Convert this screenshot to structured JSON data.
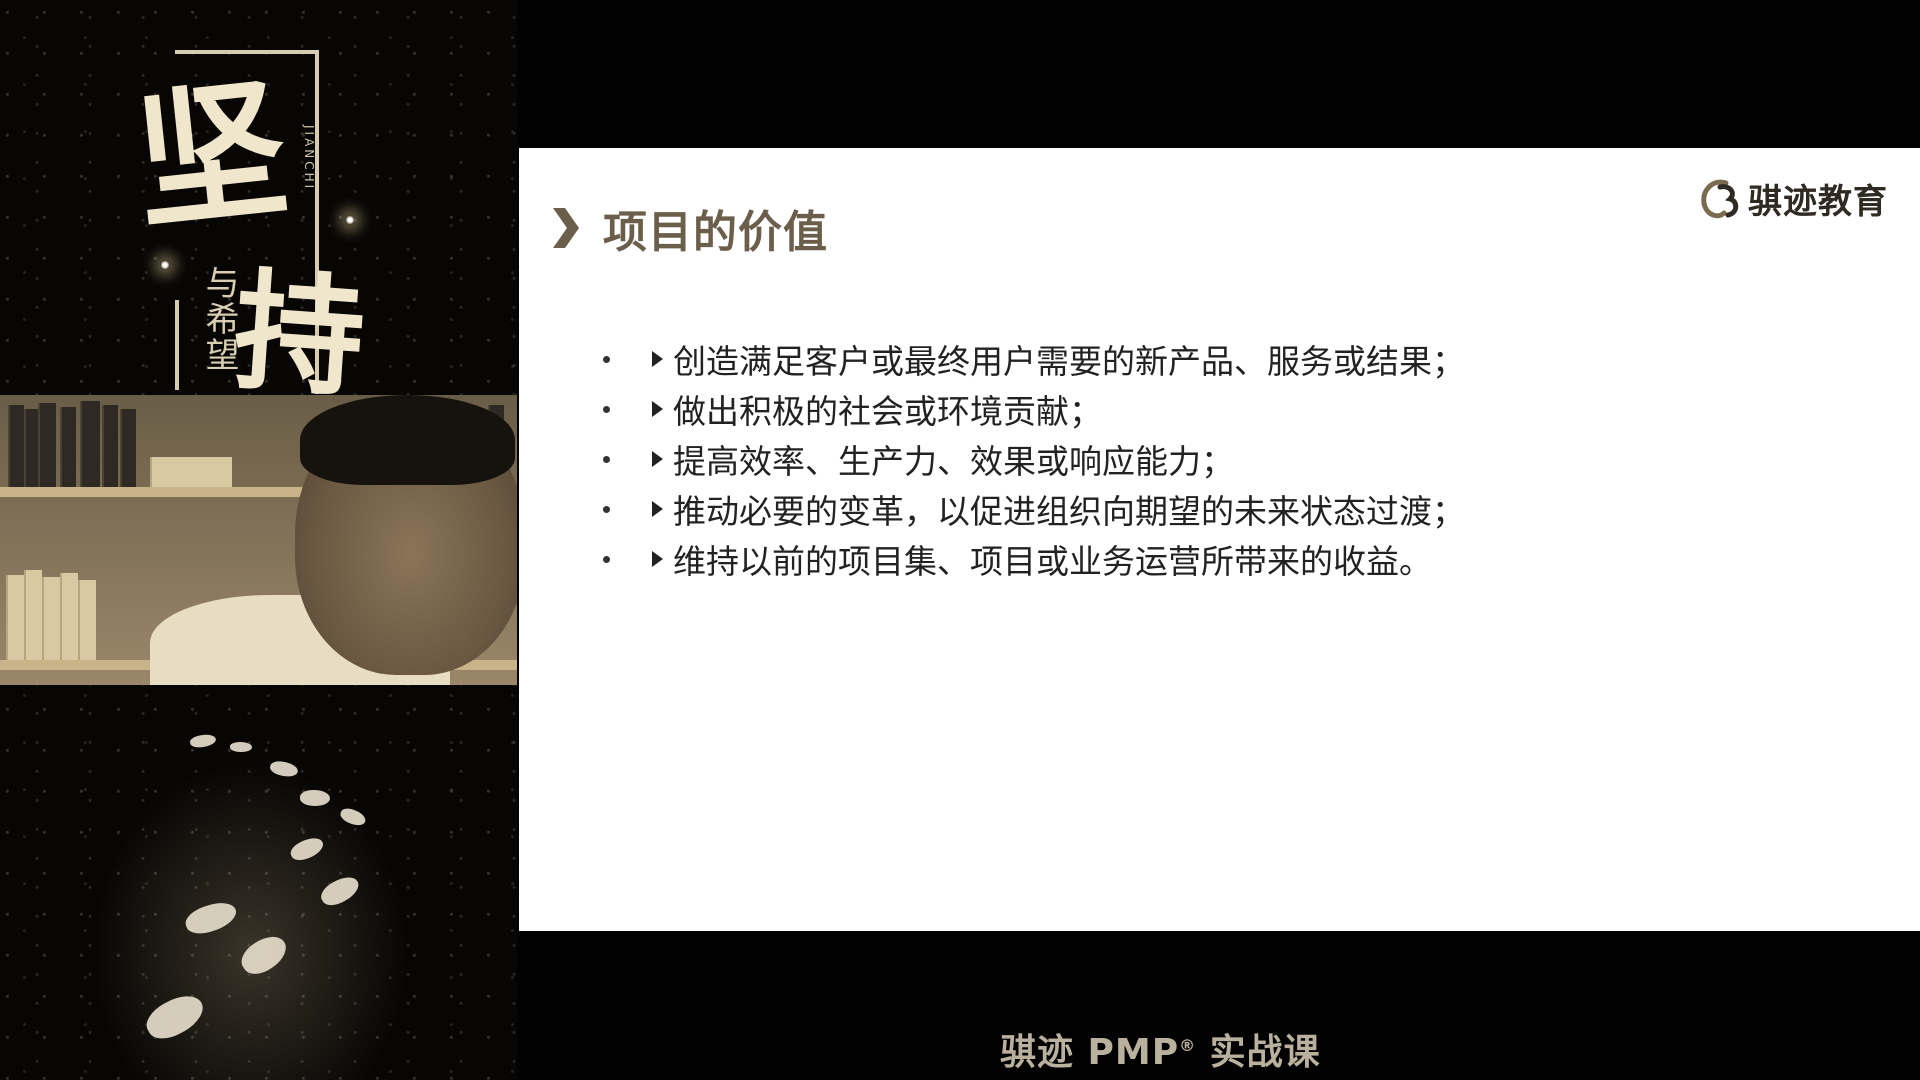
{
  "poster": {
    "main_char_1": "坚",
    "main_char_2": "持",
    "subtitle": "与希望",
    "pinyin": "JIANCHI"
  },
  "slide": {
    "title": "项目的价值",
    "brand": "骐迹教育",
    "bullets": [
      "创造满足客户或最终用户需要的新产品、服务或结果；",
      "做出积极的社会或环境贡献；",
      "提高效率、生产力、效果或响应能力；",
      "推动必要的变革，以促进组织向期望的未来状态过渡；",
      "维持以前的项目集、项目或业务运营所带来的收益。"
    ]
  },
  "caption": {
    "text_before": "骐迹 PMP",
    "registered": "®",
    "text_after": " 实战课"
  },
  "colors": {
    "title": "#6b5f4c",
    "caption": "#b9b09d",
    "slide_bg": "#ffffff",
    "page_bg": "#020202"
  }
}
